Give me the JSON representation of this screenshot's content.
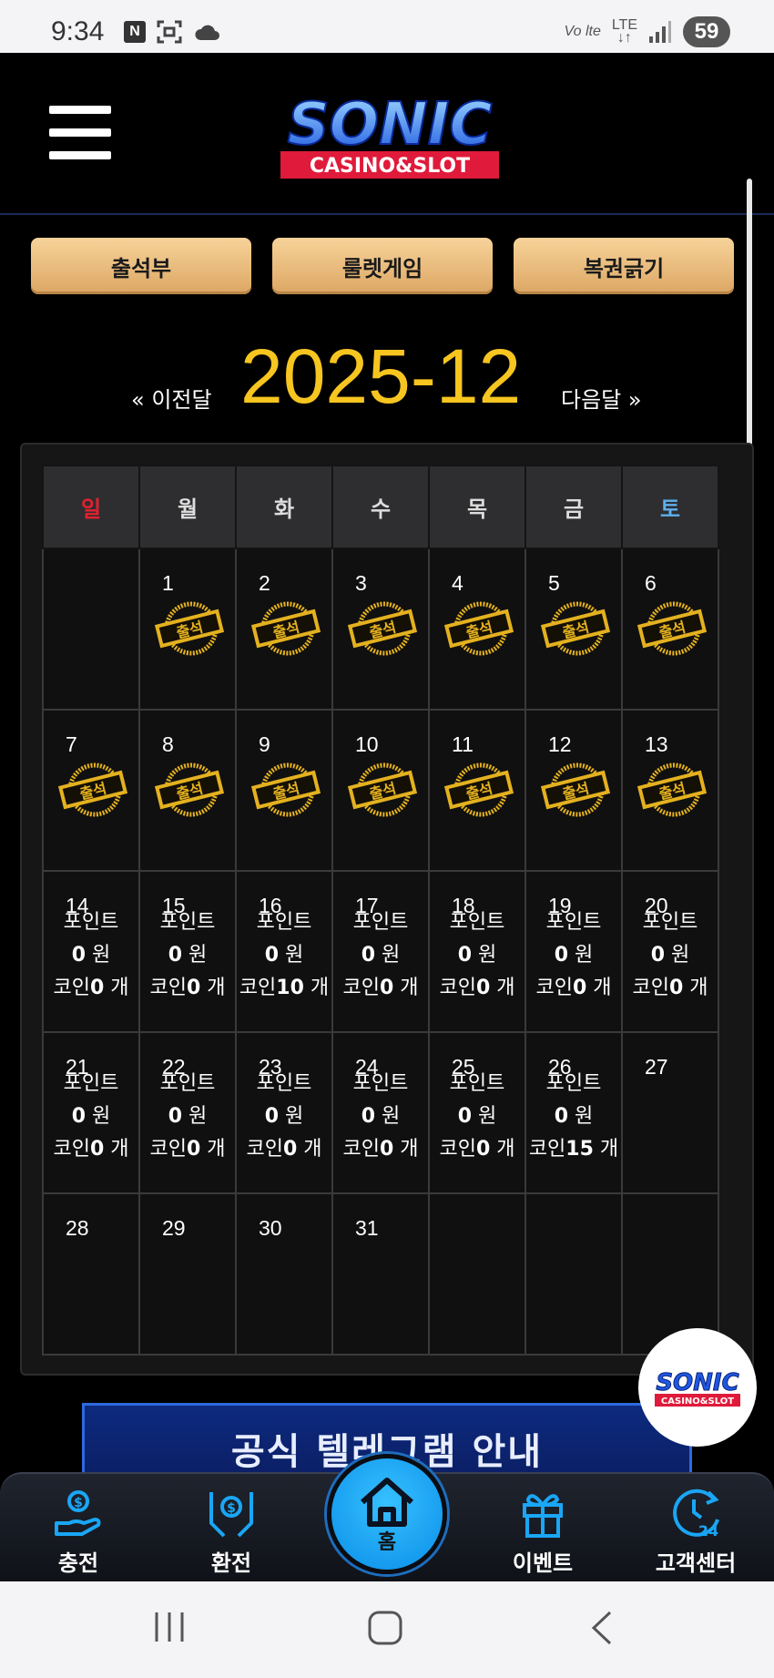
{
  "status_bar": {
    "time": "9:34",
    "badge_n": "N",
    "volte": "Vo lte",
    "lte": "LTE",
    "battery": "59"
  },
  "header": {
    "menu_icon": "hamburger-icon",
    "logo_main": "SONIC",
    "logo_sub": "CASINO&SLOT"
  },
  "top_buttons": {
    "attendance": "출석부",
    "roulette": "룰렛게임",
    "lottery": "복권긁기"
  },
  "month_nav": {
    "prev": "« 이전달",
    "title": "2025-12",
    "next": "다음달 »"
  },
  "calendar": {
    "weekdays": [
      "일",
      "월",
      "화",
      "수",
      "목",
      "금",
      "토"
    ],
    "stamp_text": "출석",
    "point_label": "포인트",
    "won_suffix": "원",
    "coin_label": "코인",
    "coin_suffix": "개",
    "weeks": [
      [
        {
          "day": "",
          "state": "empty"
        },
        {
          "day": "1",
          "state": "stamp"
        },
        {
          "day": "2",
          "state": "stamp"
        },
        {
          "day": "3",
          "state": "stamp"
        },
        {
          "day": "4",
          "state": "stamp"
        },
        {
          "day": "5",
          "state": "stamp"
        },
        {
          "day": "6",
          "state": "stamp"
        }
      ],
      [
        {
          "day": "7",
          "state": "stamp"
        },
        {
          "day": "8",
          "state": "stamp"
        },
        {
          "day": "9",
          "state": "stamp"
        },
        {
          "day": "10",
          "state": "stamp"
        },
        {
          "day": "11",
          "state": "stamp"
        },
        {
          "day": "12",
          "state": "stamp"
        },
        {
          "day": "13",
          "state": "stamp"
        }
      ],
      [
        {
          "day": "14",
          "state": "info",
          "points": "0",
          "coins": "0"
        },
        {
          "day": "15",
          "state": "info",
          "points": "0",
          "coins": "0"
        },
        {
          "day": "16",
          "state": "info",
          "points": "0",
          "coins": "10"
        },
        {
          "day": "17",
          "state": "info",
          "points": "0",
          "coins": "0"
        },
        {
          "day": "18",
          "state": "info",
          "points": "0",
          "coins": "0"
        },
        {
          "day": "19",
          "state": "info",
          "points": "0",
          "coins": "0"
        },
        {
          "day": "20",
          "state": "info",
          "points": "0",
          "coins": "0"
        }
      ],
      [
        {
          "day": "21",
          "state": "info",
          "points": "0",
          "coins": "0"
        },
        {
          "day": "22",
          "state": "info",
          "points": "0",
          "coins": "0"
        },
        {
          "day": "23",
          "state": "info",
          "points": "0",
          "coins": "0"
        },
        {
          "day": "24",
          "state": "info",
          "points": "0",
          "coins": "0"
        },
        {
          "day": "25",
          "state": "info",
          "points": "0",
          "coins": "0"
        },
        {
          "day": "26",
          "state": "info",
          "points": "0",
          "coins": "15"
        },
        {
          "day": "27",
          "state": "plain"
        }
      ],
      [
        {
          "day": "28",
          "state": "plain"
        },
        {
          "day": "29",
          "state": "plain"
        },
        {
          "day": "30",
          "state": "plain"
        },
        {
          "day": "31",
          "state": "plain"
        },
        {
          "day": "",
          "state": "empty"
        },
        {
          "day": "",
          "state": "empty"
        },
        {
          "day": "",
          "state": "empty"
        }
      ]
    ]
  },
  "float_badge": {
    "main": "SONIC",
    "sub": "CASINO&SLOT"
  },
  "banner": {
    "text": "공식 텔레그램 안내"
  },
  "bottom_nav": {
    "deposit": "충전",
    "withdraw": "환전",
    "home": "홈",
    "event": "이벤트",
    "support": "고객센터"
  },
  "colors": {
    "accent_gold": "#f6c51f",
    "button_gold": "#e6b676",
    "nav_blue": "#1aa6f5",
    "sunday_red": "#e5202e",
    "saturday_blue": "#5fb0ef"
  }
}
